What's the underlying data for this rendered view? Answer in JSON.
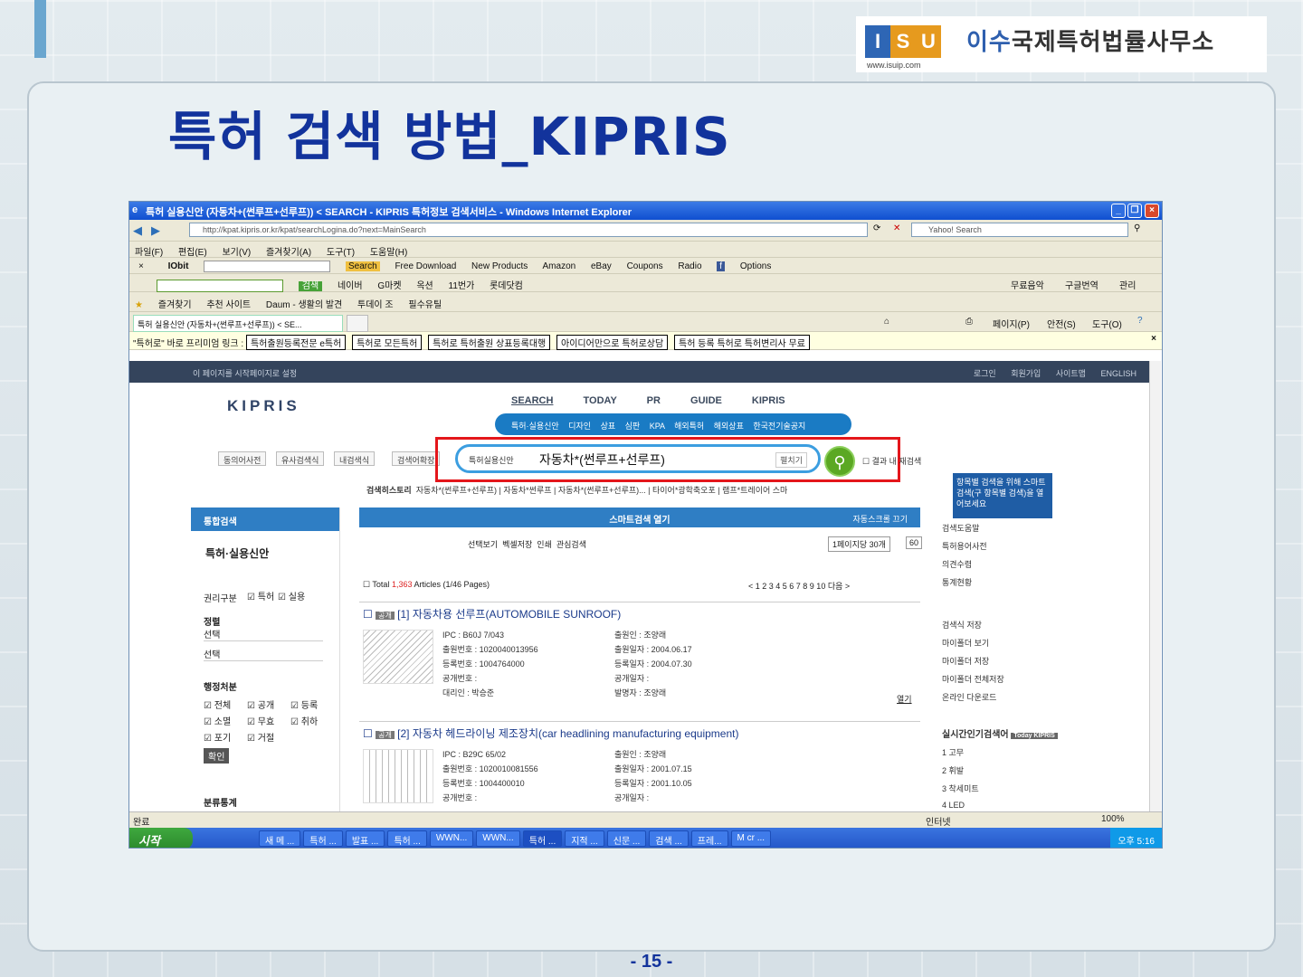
{
  "logo": {
    "letters": [
      "I",
      "S",
      "U"
    ],
    "letter_colors": [
      "#2e66b5",
      "#e69a1e",
      "#e69a1e"
    ],
    "url": "www.isuip.com",
    "firm_a": "이수",
    "firm_b": "국제특허법률사무소"
  },
  "slide": {
    "title": "특허 검색 방법_KIPRIS",
    "page": "- 15 -"
  },
  "ie": {
    "title": "특허 실용신안 (자동차+(썬루프+선루프)) < SEARCH - KIPRIS 특허정보 검색서비스 - Windows Internet Explorer",
    "address": "http://kpat.kipris.or.kr/kpat/searchLogina.do?next=MainSearch",
    "yahoo_search": "Yahoo! Search",
    "menu": [
      "파일(F)",
      "편집(E)",
      "보기(V)",
      "즐겨찾기(A)",
      "도구(T)",
      "도움말(H)"
    ],
    "toolbar": [
      "Search",
      "Free Download",
      "New Products",
      "Amazon",
      "eBay",
      "Coupons",
      "Radio",
      "Options"
    ],
    "toolbar2": [
      "검색",
      "네이버",
      "G마켓",
      "옥션",
      "11번가",
      "롯데닷컴",
      "무료음악",
      "구글번역",
      "관리"
    ],
    "favorites": [
      "즐겨찾기",
      "추천 사이트",
      "Daum - 생활의 발견",
      "투데이 조",
      "필수유틸"
    ],
    "tab": "특허 실용신안 (자동차+(썬루프+선루프)) < SE...",
    "page_menu": [
      "페이지(P)",
      "안전(S)",
      "도구(O)"
    ],
    "notice_lead": "\"특허로\" 바로 프리미엄 링크 :",
    "notice_links": [
      "특허출원등록전문 e특허",
      "특허로 모든특허",
      "특허로 특허출원 상표등록대행",
      "아이디어만으로 특허로상담",
      "특허 등록 특허로 특허변리사 무료"
    ],
    "status": "완료",
    "zoom": "100%",
    "zone": "인터넷"
  },
  "kipris": {
    "topbar_left": "이 페이지를 시작페이지로 설정",
    "topbar_right": [
      "로그인",
      "회원가입",
      "사이트맵",
      "ENGLISH"
    ],
    "logo": "KIPRIS",
    "nav": [
      "SEARCH",
      "TODAY",
      "PR",
      "GUIDE",
      "KIPRIS"
    ],
    "subnav": [
      "특허·실용신안",
      "디자인",
      "상표",
      "심판",
      "KPA",
      "해외특허",
      "해외상표",
      "한국전기술공지"
    ],
    "search_buttons": [
      "동의어사전",
      "유사검색식",
      "내검색식",
      "검색어확장"
    ],
    "search_category": "특허실용신안",
    "search_query": "자동차*(썬루프+선루프)",
    "expand": "펼치기",
    "within": "결과 내 재검색",
    "history_label": "검색히스토리",
    "history": [
      "자동차*(썬루프+선루프)",
      "자동차*썬루프",
      "자동차*(썬루프+선루프)...",
      "타이어*광학축오포",
      "램프*트레이어 스마"
    ],
    "tip": "항목별 검색을 위해 스마트검색(구 항목별 검색)을 열어보세요",
    "left_head": "통합검색",
    "left_section": "특허·실용신안",
    "right_group": "권리구분",
    "right_opts": [
      "특허",
      "실용"
    ],
    "sort_label": "정렬",
    "sort1": "선택",
    "sort2": "선택",
    "admin_label": "행정처분",
    "admin_opts": [
      "전체",
      "공개",
      "등록",
      "소멸",
      "무효",
      "취하",
      "포기",
      "거절"
    ],
    "confirm": "확인",
    "stats_label": "분류통계",
    "smart_open": "스마트검색 열기",
    "fold": "자동스크롤 끄기",
    "view_opts": [
      "선택보기",
      "벡셀저장",
      "인쇄",
      "관심검색"
    ],
    "per_page": "1페이지당 30개",
    "per_page_btn": "60",
    "total_prefix": "Total",
    "total_count": "1,363",
    "total_suffix": "Articles (1/46 Pages)",
    "pager": "< 1 2 3 4 5 6 7 8 9 10 다음 >",
    "results": [
      {
        "badge": "공개",
        "title": "[1] 자동차용 선루프(AUTOMOBILE SUNROOF)",
        "ipc": "IPC : B60J 7/043",
        "appno": "출원번호 : 1020040013956",
        "regno": "등록번호 : 1004764000",
        "pubno": "공개번호 :",
        "applicant": "대리인 : 박승준",
        "inventor": "출원인 : 조양래",
        "appdate": "출원일자 : 2004.06.17",
        "regdate": "등록일자 : 2004.07.30",
        "pubdate": "공개일자 :",
        "maker": "발명자 : 조양래",
        "detail": "열기"
      },
      {
        "badge": "공개",
        "title": "[2] 자동차 헤드라이닝 제조장치(car headlining manufacturing equipment)",
        "ipc": "IPC : B29C 65/02",
        "appno": "출원번호 : 1020010081556",
        "regno": "등록번호 : 1004400010",
        "pubno": "공개번호 :",
        "applicant": "",
        "inventor": "출원인 : 조양래",
        "appdate": "출원일자 : 2001.07.15",
        "regdate": "등록일자 : 2001.10.05",
        "pubdate": "공개일자 :",
        "maker": "",
        "detail": ""
      }
    ],
    "side_links": [
      "검색도움말",
      "특허용어사전",
      "의견수렴",
      "통계현황"
    ],
    "side_links2": [
      "검색식 저장",
      "마이폴더 보기",
      "마이폴더 저장",
      "마이폴더 전체저장",
      "온라인 다운로드"
    ],
    "realtime_label": "실시간인기검색어",
    "realtime_badge": "Today KIPRIS",
    "realtime": [
      "1 고무",
      "2 휘발",
      "3 착세미트",
      "4 LED"
    ]
  },
  "taskbar": {
    "start": "시작",
    "items": [
      "새 메 ...",
      "특허 ...",
      "발표 ...",
      "특허 ...",
      "WWN...",
      "WWN...",
      "특허 ...",
      "지적 ...",
      "신문 ...",
      "검색 ...",
      "프레...",
      "M cr ..."
    ],
    "clock": "오후 5:16"
  },
  "colors": {
    "title": "#12339c",
    "kipris_blue": "#2f7ec4",
    "red_box": "#e4161b",
    "go_green": "#5ba823"
  }
}
